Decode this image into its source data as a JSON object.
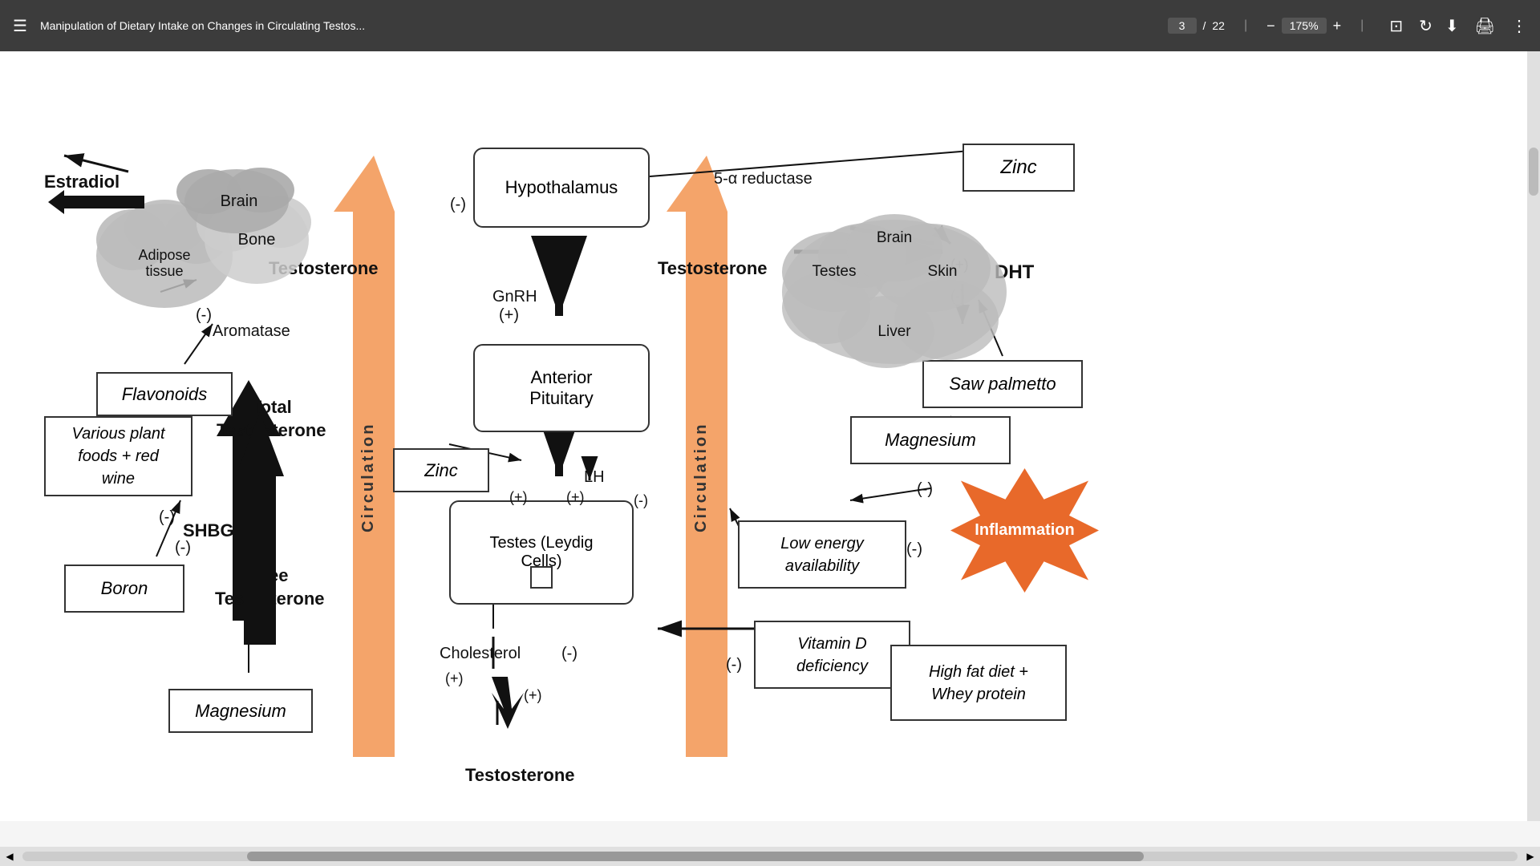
{
  "toolbar": {
    "menu_icon": "☰",
    "title": "Manipulation of Dietary Intake on Changes in Circulating Testos...",
    "page_current": "3",
    "page_separator": "/",
    "page_total": "22",
    "zoom_minus": "−",
    "zoom_value": "175%",
    "zoom_plus": "+",
    "fit_icon": "⊡",
    "rotate_icon": "↻",
    "download_icon": "⬇",
    "print_icon": "🖨",
    "more_icon": "⋮"
  },
  "scrollbar": {
    "left_arrow": "◀",
    "right_arrow": "▶"
  },
  "diagram": {
    "hypothalamus": "Hypothalamus",
    "anterior_pituitary": "Anterior\nPituitary",
    "testes": "Testes (Leydig\nCells)",
    "dht": "DHT",
    "zinc_top_right": "Zinc",
    "zinc_left": "Zinc",
    "saw_palmetto": "Saw palmetto",
    "magnesium_top": "Magnesium",
    "magnesium_bottom": "Magnesium",
    "flavonoids": "Flavonoids",
    "various_plant": "Various plant\nfoods + red\nwine",
    "boron": "Boron",
    "low_energy": "Low energy\navailability",
    "vitamin_d": "Vitamin D\ndeficiency",
    "high_fat_diet": "High fat diet +\nWhey protein",
    "inflammation": "Inflammation",
    "estradiol": "Estradiol",
    "testosterone_left": "Testosterone",
    "testosterone_right": "Testosterone",
    "testosterone_bottom": "Testosterone",
    "total_testosterone": "Total\nTestosterone",
    "free_testosterone": "Free\nTestosterone",
    "shbg": "SHBG",
    "gnrh": "GnRH",
    "gnrh_plus": "(+)",
    "lh": "LH",
    "lh_plus1": "(+)",
    "lh_plus2": "(+)",
    "lh_minus": "(-)",
    "cholesterol": "Cholesterol",
    "cholesterol_plus1": "(+)",
    "cholesterol_plus2": "(+)",
    "cholesterol_minus": "(-)",
    "aromatase": "Aromatase",
    "aromatase_minus": "(-)",
    "shbg_minus": "(-)",
    "boron_minus": "(-)",
    "five_alpha": "5-α reductase",
    "dht_plus": "(+)",
    "dht_minus": "(-)",
    "hypo_minus": "(-)",
    "circulation1": "Circulation",
    "circulation2": "Circulation",
    "brain_left": "Brain",
    "bone": "Bone",
    "adipose": "Adipose\ntissue",
    "brain_right": "Brain",
    "testes_cloud": "Testes",
    "skin": "Skin",
    "liver": "Liver",
    "low_energy_minus": "(-)",
    "vitamin_d_minus": "(-)"
  }
}
